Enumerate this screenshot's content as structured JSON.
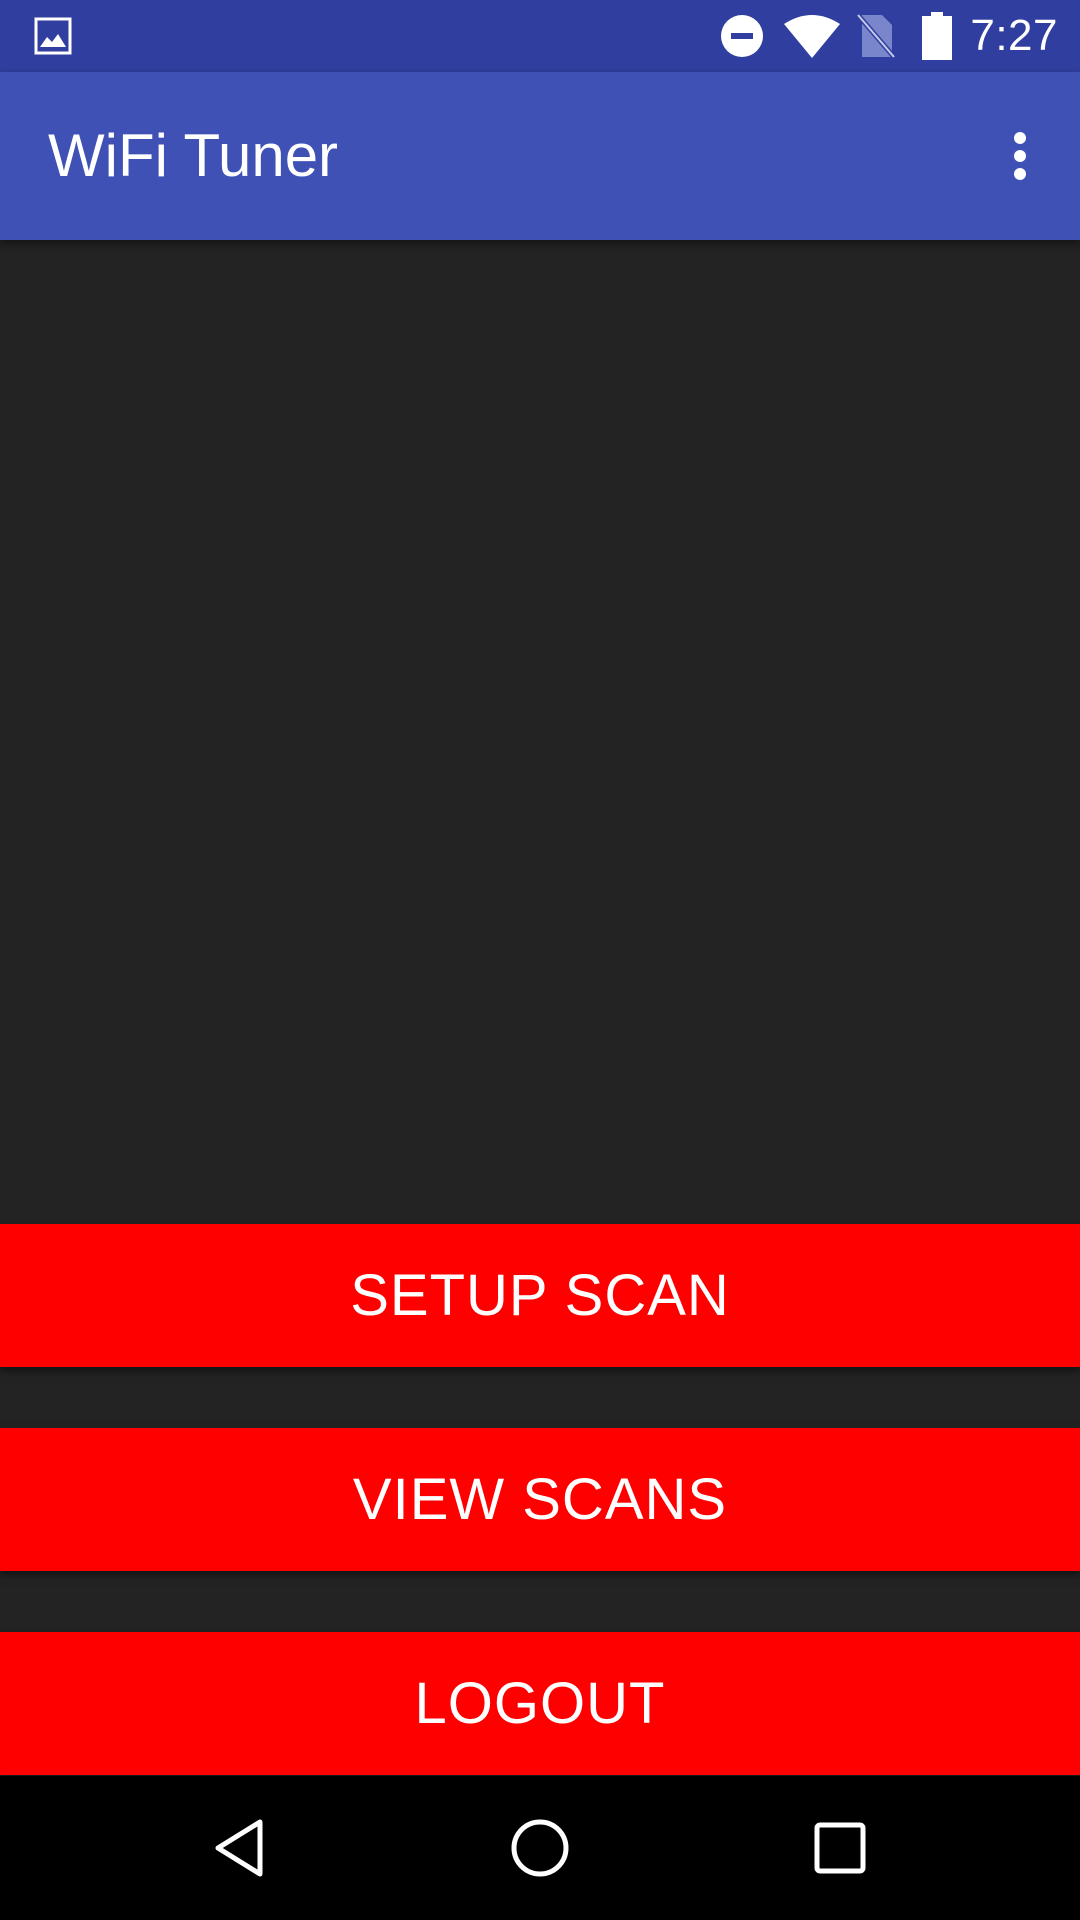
{
  "status_bar": {
    "time": "7:27",
    "icons": [
      "image-notification-icon",
      "do-not-disturb-icon",
      "wifi-icon",
      "no-sim-icon",
      "battery-icon"
    ],
    "background": "#303F9F"
  },
  "app_bar": {
    "title": "WiFi Tuner",
    "menu_icon": "overflow-menu-icon",
    "background": "#3F51B5"
  },
  "actions": {
    "setup_scan": "SETUP SCAN",
    "view_scans": "VIEW SCANS",
    "logout": "LOGOUT",
    "button_color": "#FF0000"
  },
  "nav_bar": {
    "icons": [
      "back-icon",
      "home-icon",
      "recents-icon"
    ]
  },
  "colors": {
    "content_background": "#232323",
    "nav_background": "#000000"
  }
}
